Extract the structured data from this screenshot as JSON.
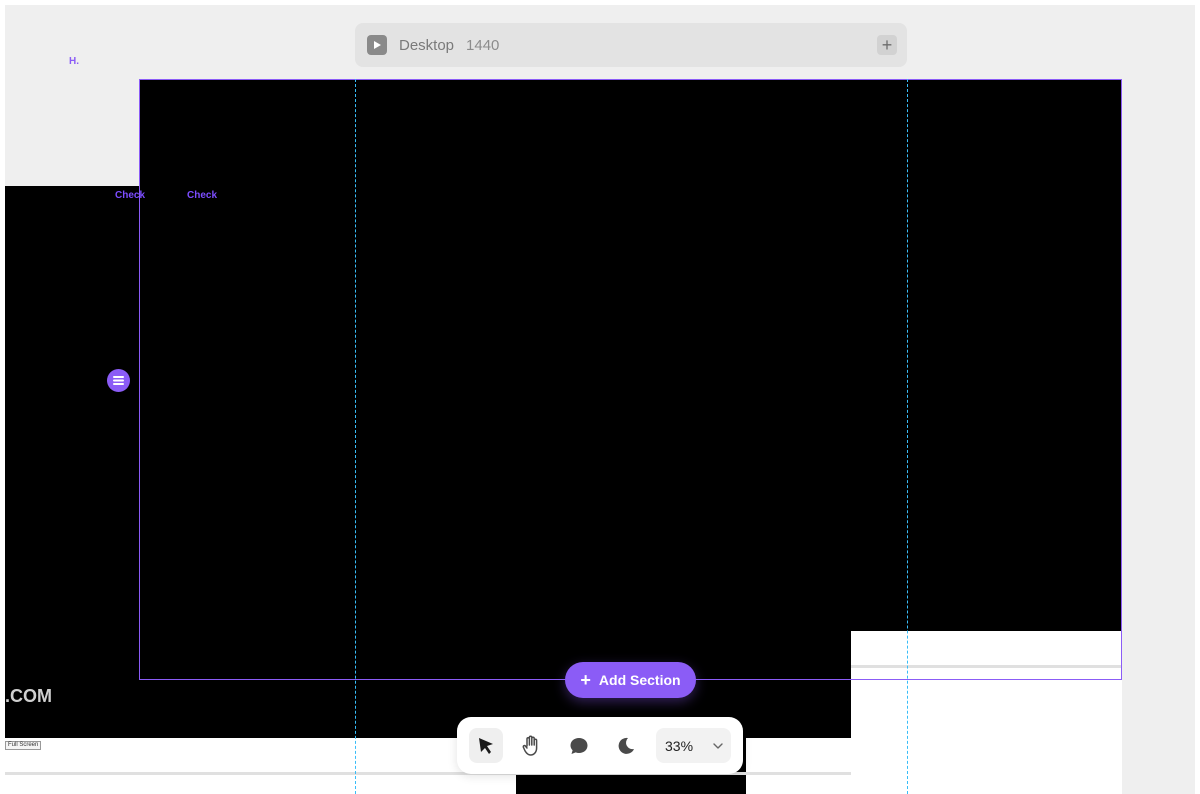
{
  "device_bar": {
    "device_name": "Desktop",
    "device_width": "1440",
    "add_label": "+"
  },
  "logo": {
    "text": "H."
  },
  "nav": {
    "links": [
      "Check",
      "Check"
    ]
  },
  "page": {
    "com_text": ".COM",
    "fullscreen_label": "Full Screen"
  },
  "add_section": {
    "plus": "+",
    "label": "Add Section"
  },
  "toolbar": {
    "tools": [
      "pointer-icon",
      "hand-icon",
      "comment-icon",
      "moon-icon"
    ],
    "active_tool": "pointer-icon",
    "zoom": "33%"
  },
  "colors": {
    "accent": "#8b5cf6",
    "guide": "#38bdf8",
    "canvas": "#efefef"
  }
}
